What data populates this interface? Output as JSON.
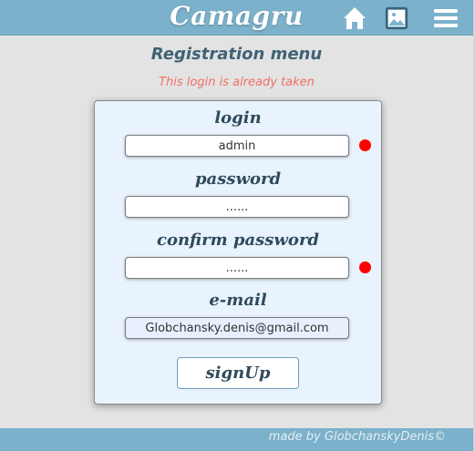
{
  "header": {
    "brand": "Camagru",
    "nav": {
      "home_icon": "home-icon",
      "gallery_icon": "image-icon",
      "menu_icon": "hamburger-menu-icon"
    }
  },
  "page": {
    "title": "Registration menu",
    "error": "This login is already taken"
  },
  "form": {
    "login_label": "login",
    "login_value": "admin",
    "password_label": "password",
    "password_value": "......",
    "confirm_label": "confirm password",
    "confirm_value": "......",
    "email_label": "e-mail",
    "email_value": "Globchansky.denis@gmail.com",
    "submit_label": "signUp"
  },
  "footer": {
    "credit": "made by GlobchanskyDenis©"
  },
  "colors": {
    "header_bg": "#7bb1cb",
    "card_bg": "#e8f3fd",
    "error": "#ef7064",
    "invalid_dot": "#ff0000"
  }
}
